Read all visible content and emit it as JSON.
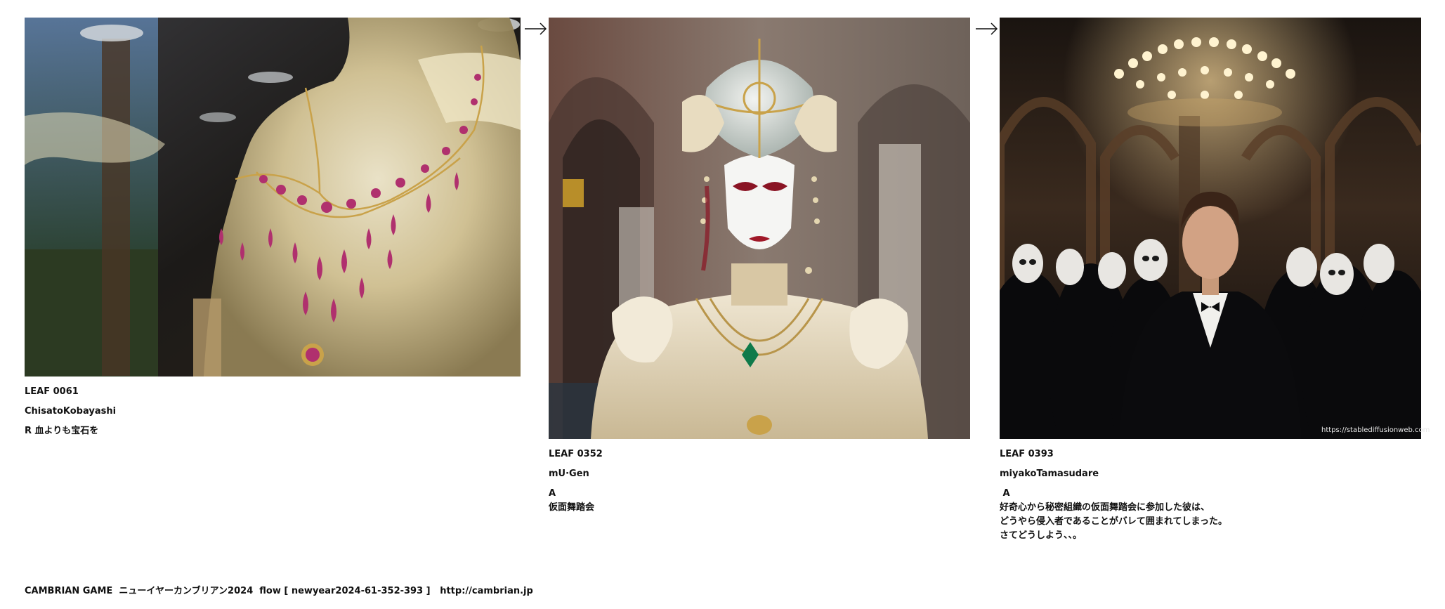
{
  "cards": [
    {
      "id": "LEAF 0061",
      "author": "ChisatoKobayashi",
      "rating": "R 血よりも宝石を",
      "comment": "",
      "image_alt": "translucent mannequin torso wearing a gold necklace with dangling magenta gemstones in a shop window"
    },
    {
      "id": "LEAF 0352",
      "author": "mU·Gen",
      "rating": "A",
      "comment": "仮面舞踏会",
      "image_alt": "figure in ornate white and gold carnival costume with white mask and domed headdress under stone arches"
    },
    {
      "id": "LEAF 0393",
      "author": "miyakoTamasudare",
      "rating": " A",
      "comment": "好奇心から秘密組織の仮面舞踏会に参加した彼は、\nどうやら侵入者であることがバレて囲まれてしまった。\nさてどうしよう、、。",
      "image_alt": "man in black tuxedo surrounded by masked figures under a chandelier in a gothic hall",
      "watermark": "https://stablediffusionweb.com"
    }
  ],
  "arrows": [
    "arrow-right-icon",
    "arrow-right-icon"
  ],
  "footer": {
    "text": "CAMBRIAN GAME  ニューイヤーカンブリアン2024  flow [ newyear2024-61-352-393 ]   ",
    "link": "http://cambrian.jp"
  },
  "colors": {
    "text": "#111111",
    "background": "#ffffff",
    "gem_magenta": "#b0306e",
    "gold": "#c9a24a"
  }
}
